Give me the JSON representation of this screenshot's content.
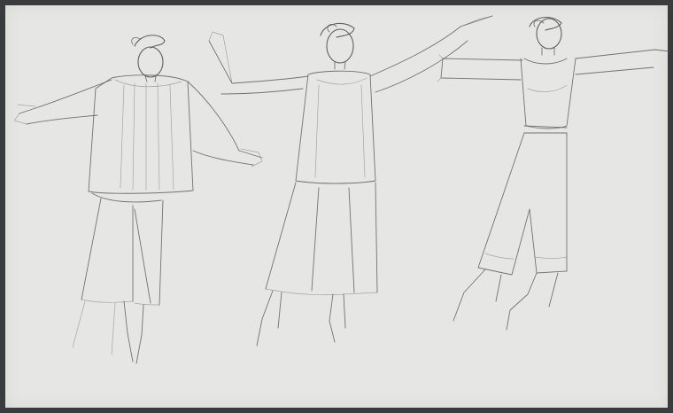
{
  "artwork": {
    "medium": "pencil-sketch",
    "paper_color": "#e6e6e4",
    "border_color": "#3a3b3d",
    "stroke_color": "#5d5e62",
    "figures": [
      "figure-1",
      "figure-2",
      "figure-3"
    ]
  }
}
